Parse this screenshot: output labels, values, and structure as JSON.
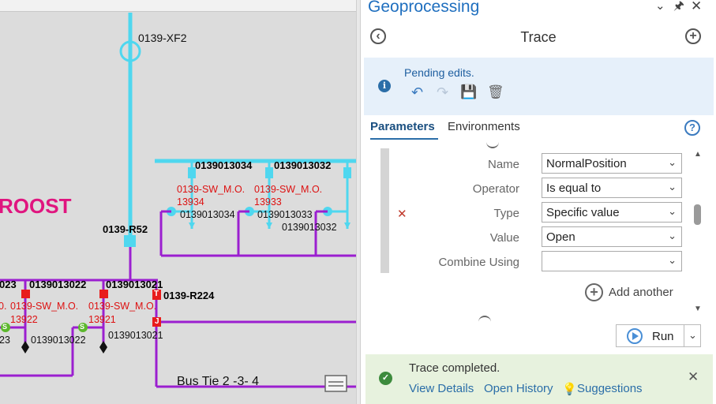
{
  "map": {
    "labels": {
      "xf2": "0139-XF2",
      "r52": "0139-R52",
      "roost": "ROOST",
      "r224": "0139-R224",
      "bus_tie": "Bus Tie 2 -3- 4",
      "fuse_34_top": "0139013034",
      "fuse_32_top": "0139013032",
      "sw_34": "0139-SW_M.O.",
      "sw_34_num": "13934",
      "sw_33": "0139-SW_M.O.",
      "sw_33_num": "13933",
      "dev_34": "0139013034",
      "dev_33": "0139013033",
      "dev_32": "0139013032",
      "top_23": "023",
      "top_22": "0139013022",
      "top_21": "0139013021",
      "sw_left": "0.",
      "sw_22": "0139-SW_M.O.",
      "sw_21": "0139-SW_M.O.",
      "num_22": "13922",
      "num_21": "13921",
      "bot_23": "23",
      "bot_22": "0139013022",
      "bot_21": "0139013021",
      "t_marker": "T",
      "j_marker": "J",
      "s_marker": "S"
    },
    "colors": {
      "feeder_cyan": "#4fd7ef",
      "purple_line": "#9b1fd0",
      "red_switch": "#e81c1c",
      "magenta_text": "#e0157f"
    }
  },
  "geoprocessing": {
    "title": "Geoprocessing",
    "header_icons": [
      "chevron-down-icon",
      "pin-icon",
      "close-icon"
    ],
    "tool_name": "Trace",
    "pending": {
      "text": "Pending edits.",
      "icons": [
        "info-icon",
        "undo-icon",
        "redo-icon",
        "save-edits-icon",
        "discard-edits-icon"
      ]
    },
    "tabs": [
      {
        "label": "Parameters",
        "active": true
      },
      {
        "label": "Environments",
        "active": false
      }
    ],
    "params": [
      {
        "label": "Name",
        "value": "NormalPosition"
      },
      {
        "label": "Operator",
        "value": "Is equal to"
      },
      {
        "label": "Type",
        "value": "Specific value"
      },
      {
        "label": "Value",
        "value": "Open"
      },
      {
        "label": "Combine Using",
        "value": ""
      }
    ],
    "add_another": "Add another",
    "run_label": "Run",
    "status": {
      "text": "Trace completed.",
      "links": [
        "View Details",
        "Open History",
        "Suggestions"
      ]
    }
  }
}
